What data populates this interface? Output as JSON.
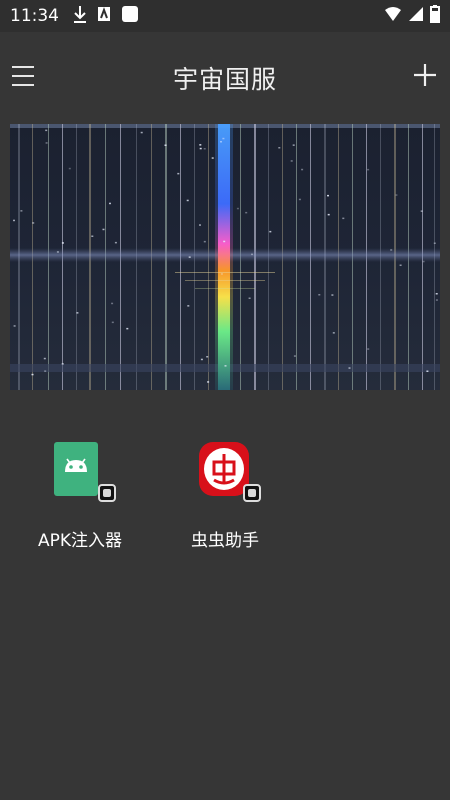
{
  "status_bar": {
    "time": "11:34",
    "icons": [
      "download-icon",
      "notification-icon",
      "square-icon",
      "wifi-icon",
      "signal-icon",
      "battery-icon"
    ]
  },
  "app_bar": {
    "title": "宇宙国服",
    "menu_icon": "menu-icon",
    "add_icon": "add-icon"
  },
  "banner": {
    "description": ""
  },
  "apps": [
    {
      "label": "APK注入器",
      "icon": "android-icon",
      "color": "#3fb27f"
    },
    {
      "label": "虫虫助手",
      "icon": "chongchong-icon",
      "color": "#d8101a"
    }
  ],
  "colors": {
    "background": "#363636",
    "status_bar": "#2f2f2f"
  }
}
